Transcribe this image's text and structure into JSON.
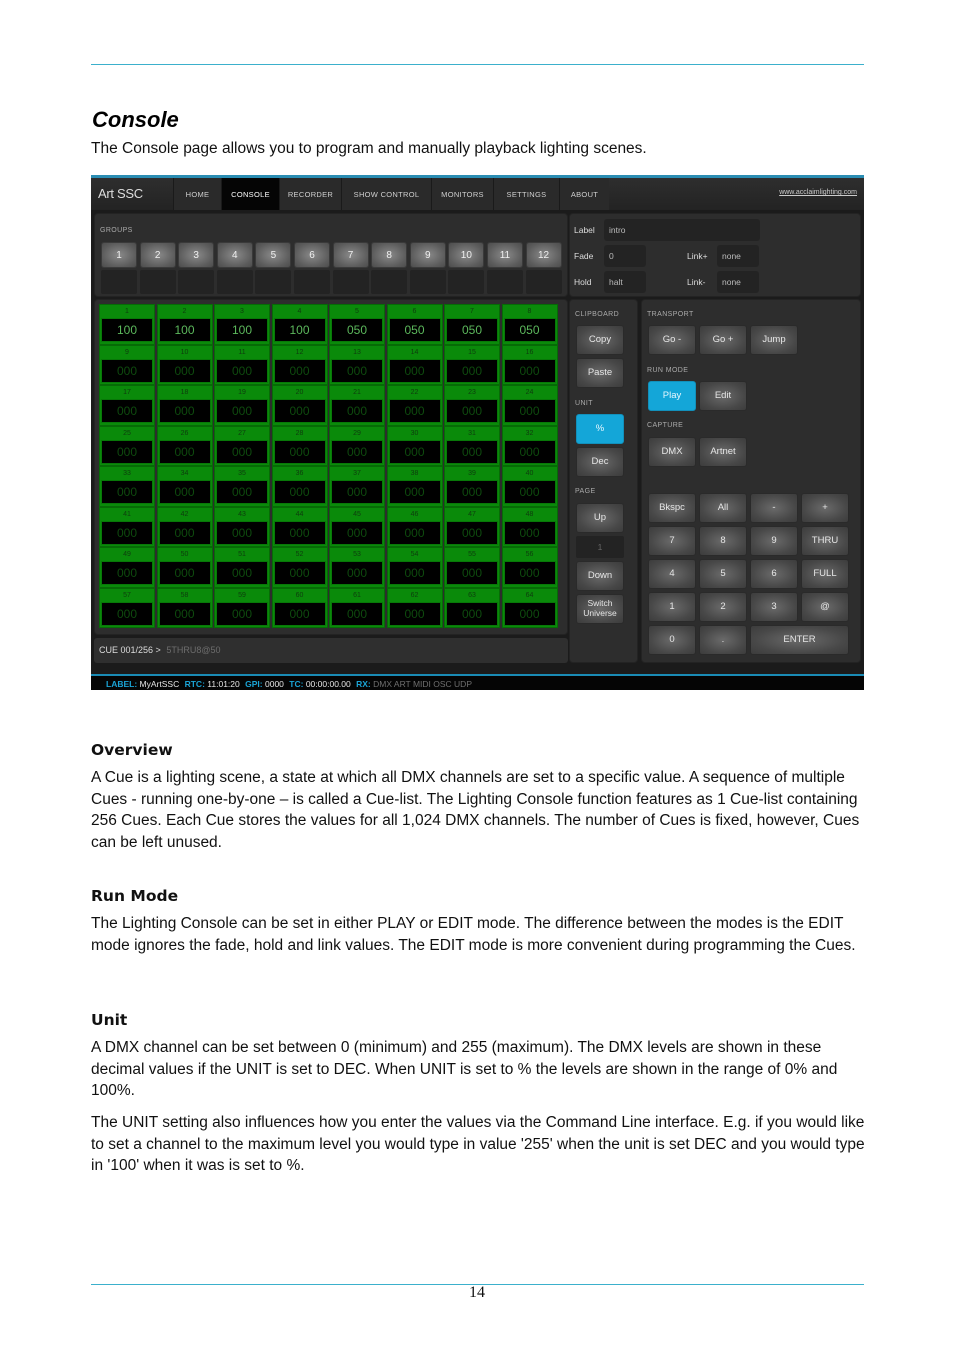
{
  "document": {
    "title": "Console",
    "intro": "The Console page allows you to program and manually playback lighting scenes.",
    "sections": [
      {
        "heading": "Overview",
        "paragraphs": [
          "A Cue is a lighting scene, a state at which all DMX channels are set to a specific value. A sequence of multiple Cues - running one-by-one – is called a Cue-list. The Lighting Console function features as 1 Cue-list containing 256 Cues. Each Cue stores the values for all 1,024 DMX channels. The number of Cues is fixed, however, Cues can be left unused."
        ]
      },
      {
        "heading": "Run Mode",
        "paragraphs": [
          "The Lighting Console can be set in either PLAY or EDIT mode. The difference between the modes is the EDIT mode ignores the fade, hold and link values. The EDIT mode is more convenient during programming the Cues."
        ]
      },
      {
        "heading": "Unit",
        "paragraphs": [
          "A DMX channel can be set between 0 (minimum) and 255 (maximum). The DMX levels are shown in these decimal values if the UNIT is set to DEC. When UNIT is set to % the levels are shown in the range of 0% and 100%.",
          "The UNIT setting also influences how you enter the values via the Command Line interface. E.g. if you would like to set a channel to the maximum level you would type in value '255' when the unit is set DEC and you would type in '100' when it was is set to %."
        ]
      }
    ],
    "page_number": "14"
  },
  "app": {
    "brand": "Art SSC",
    "nav_tabs": [
      {
        "label": "HOME",
        "active": false
      },
      {
        "label": "CONSOLE",
        "active": true
      },
      {
        "label": "RECORDER",
        "active": false
      },
      {
        "label": "SHOW CONTROL",
        "active": false
      },
      {
        "label": "MONITORS",
        "active": false
      },
      {
        "label": "SETTINGS",
        "active": false
      },
      {
        "label": "ABOUT",
        "active": false
      }
    ],
    "website_link": "www.acclaimlighting.com",
    "groups": {
      "label": "GROUPS",
      "buttons": [
        "1",
        "2",
        "3",
        "4",
        "5",
        "6",
        "7",
        "8",
        "9",
        "10",
        "11",
        "12"
      ]
    },
    "cue_info": {
      "label_label": "Label",
      "label_value": "intro",
      "fade_label": "Fade",
      "fade_value": "0",
      "hold_label": "Hold",
      "hold_value": "halt",
      "link_plus_label": "Link+",
      "link_plus_value": "none",
      "link_minus_label": "Link-",
      "link_minus_value": "none"
    },
    "channels": [
      {
        "n": "1",
        "v": "100"
      },
      {
        "n": "2",
        "v": "100"
      },
      {
        "n": "3",
        "v": "100"
      },
      {
        "n": "4",
        "v": "100"
      },
      {
        "n": "5",
        "v": "050"
      },
      {
        "n": "6",
        "v": "050"
      },
      {
        "n": "7",
        "v": "050"
      },
      {
        "n": "8",
        "v": "050"
      },
      {
        "n": "9",
        "v": "000"
      },
      {
        "n": "10",
        "v": "000"
      },
      {
        "n": "11",
        "v": "000"
      },
      {
        "n": "12",
        "v": "000"
      },
      {
        "n": "13",
        "v": "000"
      },
      {
        "n": "14",
        "v": "000"
      },
      {
        "n": "15",
        "v": "000"
      },
      {
        "n": "16",
        "v": "000"
      },
      {
        "n": "17",
        "v": "000"
      },
      {
        "n": "18",
        "v": "000"
      },
      {
        "n": "19",
        "v": "000"
      },
      {
        "n": "20",
        "v": "000"
      },
      {
        "n": "21",
        "v": "000"
      },
      {
        "n": "22",
        "v": "000"
      },
      {
        "n": "23",
        "v": "000"
      },
      {
        "n": "24",
        "v": "000"
      },
      {
        "n": "25",
        "v": "000"
      },
      {
        "n": "26",
        "v": "000"
      },
      {
        "n": "27",
        "v": "000"
      },
      {
        "n": "28",
        "v": "000"
      },
      {
        "n": "29",
        "v": "000"
      },
      {
        "n": "30",
        "v": "000"
      },
      {
        "n": "31",
        "v": "000"
      },
      {
        "n": "32",
        "v": "000"
      },
      {
        "n": "33",
        "v": "000"
      },
      {
        "n": "34",
        "v": "000"
      },
      {
        "n": "35",
        "v": "000"
      },
      {
        "n": "36",
        "v": "000"
      },
      {
        "n": "37",
        "v": "000"
      },
      {
        "n": "38",
        "v": "000"
      },
      {
        "n": "39",
        "v": "000"
      },
      {
        "n": "40",
        "v": "000"
      },
      {
        "n": "41",
        "v": "000"
      },
      {
        "n": "42",
        "v": "000"
      },
      {
        "n": "43",
        "v": "000"
      },
      {
        "n": "44",
        "v": "000"
      },
      {
        "n": "45",
        "v": "000"
      },
      {
        "n": "46",
        "v": "000"
      },
      {
        "n": "47",
        "v": "000"
      },
      {
        "n": "48",
        "v": "000"
      },
      {
        "n": "49",
        "v": "000"
      },
      {
        "n": "50",
        "v": "000"
      },
      {
        "n": "51",
        "v": "000"
      },
      {
        "n": "52",
        "v": "000"
      },
      {
        "n": "53",
        "v": "000"
      },
      {
        "n": "54",
        "v": "000"
      },
      {
        "n": "55",
        "v": "000"
      },
      {
        "n": "56",
        "v": "000"
      },
      {
        "n": "57",
        "v": "000"
      },
      {
        "n": "58",
        "v": "000"
      },
      {
        "n": "59",
        "v": "000"
      },
      {
        "n": "60",
        "v": "000"
      },
      {
        "n": "61",
        "v": "000"
      },
      {
        "n": "62",
        "v": "000"
      },
      {
        "n": "63",
        "v": "000"
      },
      {
        "n": "64",
        "v": "000"
      }
    ],
    "command_line": {
      "prefix": "CUE 001/256 >",
      "text": "5THRU8@50"
    },
    "clipboard": {
      "label": "CLIPBOARD",
      "copy": "Copy",
      "paste": "Paste"
    },
    "unit": {
      "label": "UNIT",
      "percent": "%",
      "dec": "Dec",
      "selected": "%"
    },
    "page": {
      "label": "PAGE",
      "up": "Up",
      "current": "1",
      "down": "Down",
      "switch_universe": "Switch Universe"
    },
    "transport": {
      "label": "TRANSPORT",
      "go_minus": "Go -",
      "go_plus": "Go +",
      "jump": "Jump"
    },
    "run_mode": {
      "label": "RUN MODE",
      "play": "Play",
      "edit": "Edit",
      "selected": "Play"
    },
    "capture": {
      "label": "CAPTURE",
      "dmx": "DMX",
      "artnet": "Artnet"
    },
    "keypad": [
      [
        "Bkspc",
        "All",
        "-",
        "+"
      ],
      [
        "7",
        "8",
        "9",
        "THRU"
      ],
      [
        "4",
        "5",
        "6",
        "FULL"
      ],
      [
        "1",
        "2",
        "3",
        "@"
      ],
      [
        "0",
        ".",
        "ENTER"
      ]
    ],
    "status_bar": {
      "label_key": "LABEL:",
      "label_value": "MyArtSSC",
      "rtc_key": "RTC:",
      "rtc_value": "11:01:20",
      "gpi_key": "GPI:",
      "gpi_value": "0000",
      "tc_key": "TC:",
      "tc_value": "00:00:00.00",
      "rx_key": "RX:",
      "rx_value": "DMX ART MIDI OSC UDP"
    },
    "colors": {
      "accent": "#14a6d8",
      "channel_green": "#0a8a0a",
      "status_key": "#1ba4d6"
    }
  }
}
